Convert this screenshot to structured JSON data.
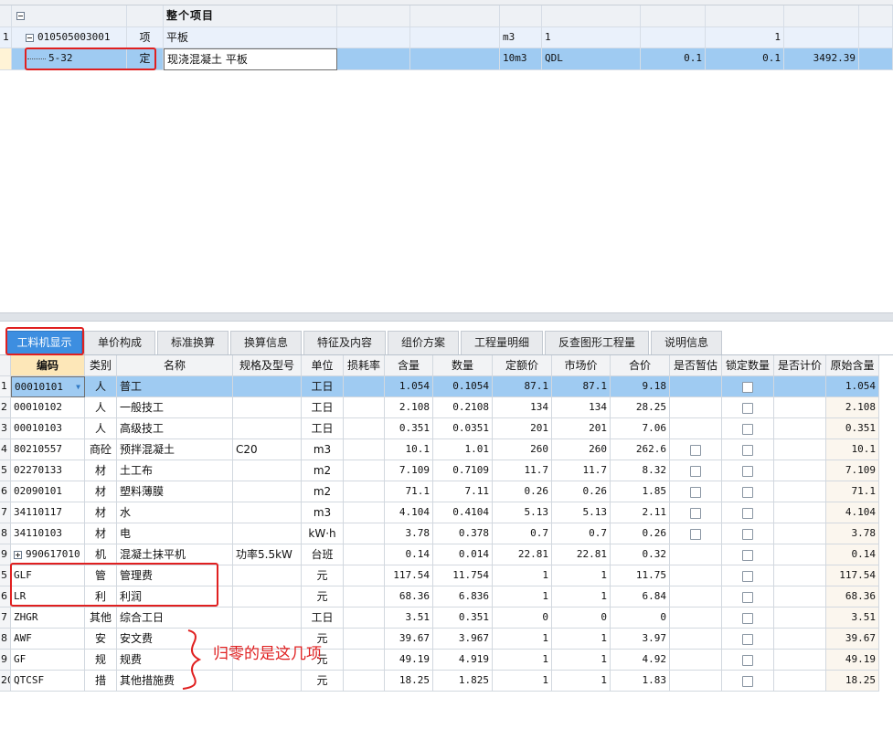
{
  "top": {
    "rows": [
      {
        "row_no": "",
        "code": "",
        "type": "",
        "name": "整个项目",
        "unit": "",
        "expr": "",
        "qty": "",
        "amt": "",
        "unitprice": "",
        "total": ""
      },
      {
        "row_no": "1",
        "code": "010505003001",
        "type": "项",
        "name": "平板",
        "unit": "m3",
        "expr": "1",
        "qty": "",
        "amt": "1",
        "unitprice": "",
        "total": ""
      },
      {
        "row_no": "",
        "code": "5-32",
        "type": "定",
        "name": "现浇混凝土 平板",
        "unit": "10m3",
        "expr": "QDL",
        "qty": "0.1",
        "amt": "0.1",
        "unitprice": "3492.39",
        "total": ""
      }
    ]
  },
  "tabs": [
    {
      "label": "工料机显示",
      "active": true
    },
    {
      "label": "单价构成"
    },
    {
      "label": "标准换算"
    },
    {
      "label": "换算信息"
    },
    {
      "label": "特征及内容"
    },
    {
      "label": "组价方案"
    },
    {
      "label": "工程量明细"
    },
    {
      "label": "反查图形工程量"
    },
    {
      "label": "说明信息"
    }
  ],
  "grid": {
    "headers": [
      "编码",
      "类别",
      "名称",
      "规格及型号",
      "单位",
      "损耗率",
      "含量",
      "数量",
      "定额价",
      "市场价",
      "合价",
      "是否暂估",
      "锁定数量",
      "是否计价",
      "原始含量"
    ],
    "rows": [
      {
        "n": "1",
        "code": "00010101",
        "cat": "人",
        "name": "普工",
        "spec": "",
        "unit": "工日",
        "loss": "",
        "content": "1.054",
        "qty": "0.1054",
        "quota": "87.1",
        "market": "87.1",
        "total": "9.18",
        "est": false,
        "lock": true,
        "orig": "1.054",
        "selected": true
      },
      {
        "n": "2",
        "code": "00010102",
        "cat": "人",
        "name": "一般技工",
        "spec": "",
        "unit": "工日",
        "loss": "",
        "content": "2.108",
        "qty": "0.2108",
        "quota": "134",
        "market": "134",
        "total": "28.25",
        "est": false,
        "lock": true,
        "orig": "2.108"
      },
      {
        "n": "3",
        "code": "00010103",
        "cat": "人",
        "name": "高级技工",
        "spec": "",
        "unit": "工日",
        "loss": "",
        "content": "0.351",
        "qty": "0.0351",
        "quota": "201",
        "market": "201",
        "total": "7.06",
        "est": false,
        "lock": true,
        "orig": "0.351"
      },
      {
        "n": "4",
        "code": "80210557",
        "cat": "商砼",
        "name": "预拌混凝土",
        "spec": "C20",
        "unit": "m3",
        "loss": "",
        "content": "10.1",
        "qty": "1.01",
        "quota": "260",
        "market": "260",
        "total": "262.6",
        "est": true,
        "lock": true,
        "orig": "10.1"
      },
      {
        "n": "5",
        "code": "02270133",
        "cat": "材",
        "name": "土工布",
        "spec": "",
        "unit": "m2",
        "loss": "",
        "content": "7.109",
        "qty": "0.7109",
        "quota": "11.7",
        "market": "11.7",
        "total": "8.32",
        "est": true,
        "lock": true,
        "orig": "7.109"
      },
      {
        "n": "6",
        "code": "02090101",
        "cat": "材",
        "name": "塑料薄膜",
        "spec": "",
        "unit": "m2",
        "loss": "",
        "content": "71.1",
        "qty": "7.11",
        "quota": "0.26",
        "market": "0.26",
        "total": "1.85",
        "est": true,
        "lock": true,
        "orig": "71.1"
      },
      {
        "n": "7",
        "code": "34110117",
        "cat": "材",
        "name": "水",
        "spec": "",
        "unit": "m3",
        "loss": "",
        "content": "4.104",
        "qty": "0.4104",
        "quota": "5.13",
        "market": "5.13",
        "total": "2.11",
        "est": true,
        "lock": true,
        "orig": "4.104"
      },
      {
        "n": "8",
        "code": "34110103",
        "cat": "材",
        "name": "电",
        "spec": "",
        "unit": "kW·h",
        "loss": "",
        "content": "3.78",
        "qty": "0.378",
        "quota": "0.7",
        "market": "0.7",
        "total": "0.26",
        "est": true,
        "lock": true,
        "orig": "3.78"
      },
      {
        "n": "9",
        "code": "990617010",
        "cat": "机",
        "name": "混凝土抹平机",
        "spec": "功率5.5kW",
        "unit": "台班",
        "loss": "",
        "content": "0.14",
        "qty": "0.014",
        "quota": "22.81",
        "market": "22.81",
        "total": "0.32",
        "est": false,
        "lock": true,
        "orig": "0.14",
        "plus": true
      },
      {
        "n": "5",
        "code": "GLF",
        "cat": "管",
        "name": "管理费",
        "spec": "",
        "unit": "元",
        "loss": "",
        "content": "117.54",
        "qty": "11.754",
        "quota": "1",
        "market": "1",
        "total": "11.75",
        "est": false,
        "lock": true,
        "orig": "117.54"
      },
      {
        "n": "6",
        "code": "LR",
        "cat": "利",
        "name": "利润",
        "spec": "",
        "unit": "元",
        "loss": "",
        "content": "68.36",
        "qty": "6.836",
        "quota": "1",
        "market": "1",
        "total": "6.84",
        "est": false,
        "lock": true,
        "orig": "68.36"
      },
      {
        "n": "7",
        "code": "ZHGR",
        "cat": "其他",
        "name": "综合工日",
        "spec": "",
        "unit": "工日",
        "loss": "",
        "content": "3.51",
        "qty": "0.351",
        "quota": "0",
        "market": "0",
        "total": "0",
        "est": false,
        "lock": true,
        "orig": "3.51"
      },
      {
        "n": "8",
        "code": "AWF",
        "cat": "安",
        "name": "安文费",
        "spec": "",
        "unit": "元",
        "loss": "",
        "content": "39.67",
        "qty": "3.967",
        "quota": "1",
        "market": "1",
        "total": "3.97",
        "est": false,
        "lock": true,
        "orig": "39.67"
      },
      {
        "n": "9",
        "code": "GF",
        "cat": "规",
        "name": "规费",
        "spec": "",
        "unit": "元",
        "loss": "",
        "content": "49.19",
        "qty": "4.919",
        "quota": "1",
        "market": "1",
        "total": "4.92",
        "est": false,
        "lock": true,
        "orig": "49.19"
      },
      {
        "n": "20",
        "code": "QTCSF",
        "cat": "措",
        "name": "其他措施费",
        "spec": "",
        "unit": "元",
        "loss": "",
        "content": "18.25",
        "qty": "1.825",
        "quota": "1",
        "market": "1",
        "total": "1.83",
        "est": false,
        "lock": true,
        "orig": "18.25"
      }
    ]
  },
  "annotation": {
    "text": "归零的是这几项",
    "color": "#e02020"
  },
  "colors": {
    "accent": "#3d8ee0",
    "selection": "#9fcbf2",
    "annotation": "#e02020"
  }
}
